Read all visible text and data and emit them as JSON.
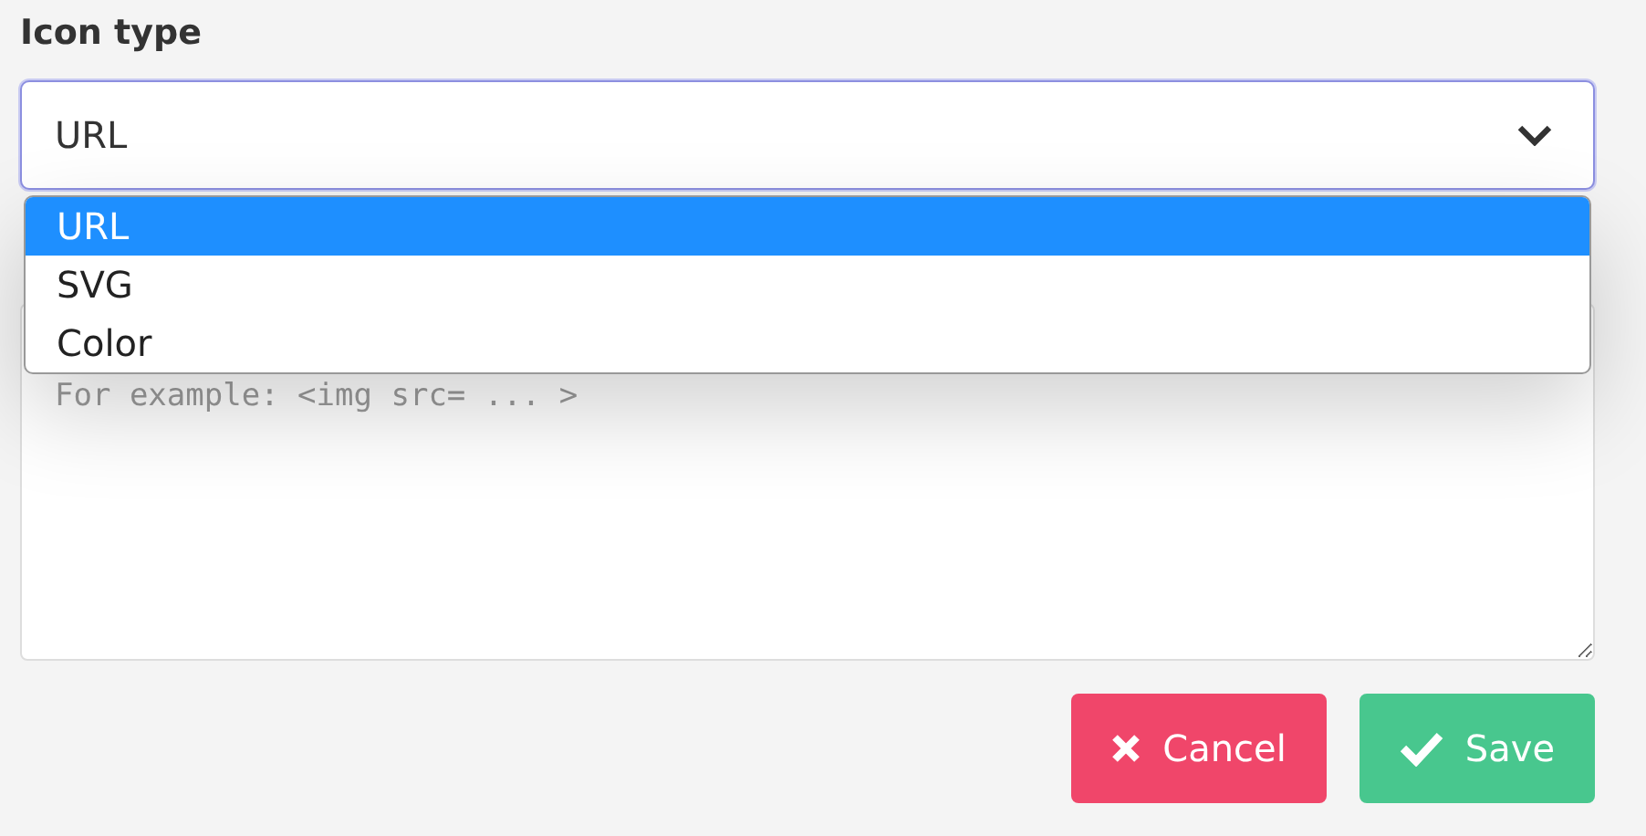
{
  "field_label": "Icon type",
  "select": {
    "value": "URL",
    "expanded": true,
    "options": [
      {
        "label": "URL",
        "selected": true
      },
      {
        "label": "SVG",
        "selected": false
      },
      {
        "label": "Color",
        "selected": false
      }
    ]
  },
  "textarea": {
    "placeholder": "For example: <img src= ... >"
  },
  "buttons": [
    {
      "label": "Cancel",
      "kind": "cancel"
    },
    {
      "label": "Save",
      "kind": "save"
    }
  ]
}
